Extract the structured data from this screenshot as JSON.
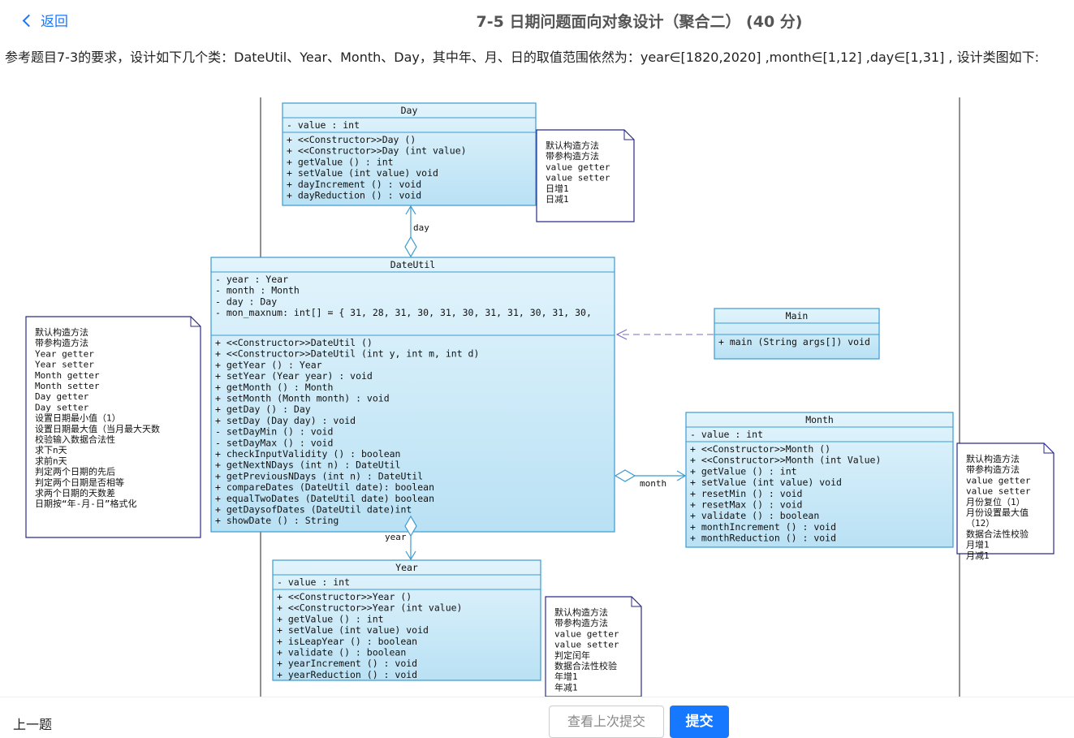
{
  "header": {
    "back_label": "返回",
    "title": "7-5 日期问题面向对象设计（聚合二） (40 分)"
  },
  "description": "参考题目7-3的要求，设计如下几个类：DateUtil、Year、Month、Day，其中年、月、日的取值范围依然为：year∈[1820,2020] ,month∈[1,12] ,day∈[1,31] , 设计类图如下:",
  "diagram": {
    "day_class": {
      "name": "Day",
      "attrs": [
        "-  value : int"
      ],
      "methods": [
        "+  <<Constructor>>Day  ()",
        "+  <<Constructor>>Day  (int value)",
        "+                 getValue  ()          : int",
        "+                 setValue  (int value) void",
        "+                 dayIncrement  ()      : void",
        "+                 dayReduction  ()      : void"
      ]
    },
    "day_note": [
      "默认构造方法",
      "带参构造方法",
      "value getter",
      "value setter",
      "日增1",
      "日减1"
    ],
    "dateutil_class": {
      "name": "DateUtil",
      "attrs": [
        "-  year        : Year",
        "-  month       : Month",
        "-  day         : Day",
        "-  mon_maxnum: int[] = { 31,  28,  31,  30,  31,  30,  31,  31,  30,  31,  30,"
      ],
      "methods": [
        "+  <<Constructor>>DateUtil  ()",
        "+  <<Constructor>>DateUtil  (int y,  int m,  int d)",
        "+                 getYear  ()                    : Year",
        "+                 setYear  (Year year)           : void",
        "+                 getMonth  ()                   : Month",
        "+                 setMonth  (Month month)        : void",
        "+                 getDay  ()                     : Day",
        "+                 setDay  (Day day)              : void",
        "-                 setDayMin  ()                  : void",
        "-                 setDayMax  ()                  : void",
        "+                 checkInputValidity  ()         : boolean",
        "+                 getNextNDays  (int n)          : DateUtil",
        "+                 getPreviousNDays  (int n)      : DateUtil",
        "+                 compareDates  (DateUtil date): boolean",
        "+                 equalTwoDates  (DateUtil date) boolean",
        "+                 getDaysofDates  (DateUtil date)int",
        "+                 showDate  ()                   : String"
      ]
    },
    "dateutil_note": [
      "默认构造方法",
      "带参构造方法",
      "Year getter",
      "Year setter",
      "Month getter",
      "Month setter",
      "Day getter",
      "Day setter",
      "设置日期最小值（1）",
      "设置日期最大值（当月最大天数",
      "校验输入数据合法性",
      "求下n天",
      "求前n天",
      "判定两个日期的先后",
      "判定两个日期是否相等",
      "求两个日期的天数差",
      "日期按“年-月-日”格式化"
    ],
    "main_class": {
      "name": "Main",
      "methods": [
        "+  main  (String args[])  void"
      ]
    },
    "month_class": {
      "name": "Month",
      "attrs": [
        "-  value : int"
      ],
      "methods": [
        "+  <<Constructor>>Month  ()",
        "+  <<Constructor>>Month  (int Value)",
        "+                 getValue  ()          : int",
        "+                 setValue  (int value) void",
        "+                 resetMin  ()          : void",
        "+                 resetMax  ()          : void",
        "+                 validate  ()          : boolean",
        "+                 monthIncrement  ()    : void",
        "+                 monthReduction  ()    : void"
      ]
    },
    "month_note": [
      "默认构造方法",
      "带参构造方法",
      "value getter",
      "value setter",
      "月份复位（1）",
      "月份设置最大值",
      "（12）",
      "数据合法性校验",
      "月增1",
      "月减1"
    ],
    "year_class": {
      "name": "Year",
      "attrs": [
        "-  value : int"
      ],
      "methods": [
        "+  <<Constructor>>Year  ()",
        "+  <<Constructor>>Year  (int value)",
        "+                 getValue  ()          : int",
        "+                 setValue  (int value) void",
        "+                 isLeapYear  ()        : boolean",
        "+                 validate  ()          : boolean",
        "+                 yearIncrement  ()     : void",
        "+                 yearReduction  ()     : void"
      ]
    },
    "year_note": [
      "默认构造方法",
      "带参构造方法",
      "value getter",
      "value setter",
      "判定闰年",
      "数据合法性校验",
      "年增1",
      "年减1"
    ],
    "labels": {
      "day": "day",
      "month": "month",
      "year": "year"
    }
  },
  "footer": {
    "prev_label": "上一题",
    "view_last_label": "查看上次提交",
    "submit_label": "提交"
  },
  "colors": {
    "accent": "#1677ff",
    "uml_fill": "#d7effa",
    "uml_border": "#3a9bd0",
    "note_border": "#2a2a8a"
  }
}
